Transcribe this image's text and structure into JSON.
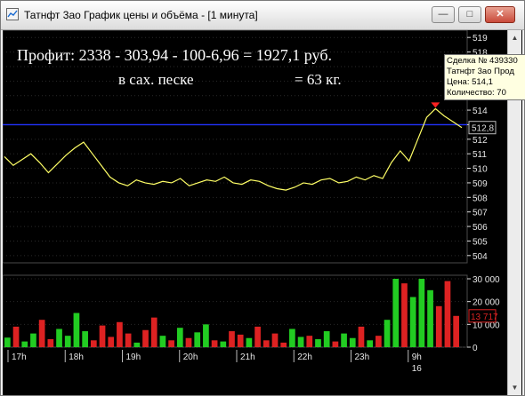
{
  "window": {
    "title": "Татнфт 3ао График цены и объёма - [1 минута]",
    "min_glyph": "—",
    "max_glyph": "□",
    "close_glyph": "✕",
    "icon": "chart-app-icon"
  },
  "overlay": {
    "line1": "Профит:  2338 - 303,94 - 100-6,96 = 1927,1 руб.",
    "line2a": "в сах. песке",
    "line2b": "= 63 кг."
  },
  "tooltip": {
    "line1": "Сделка № 439330",
    "line2": "Татнфт 3ао Прод",
    "line3": "Цена: 514,1",
    "line4": "Количество: 70"
  },
  "colors": {
    "price_line": "#ffff66",
    "level_line": "#2233ff",
    "volume_up": "#22cc22",
    "volume_down": "#dd2222",
    "price_marker": "#ff2222"
  },
  "chart_data": [
    {
      "type": "line",
      "title": "",
      "ylim": [
        503.5,
        519.5
      ],
      "y_ticks": [
        "519",
        "518",
        "517",
        "516",
        "515",
        "514",
        "513",
        "512",
        "511",
        "510",
        "509",
        "508",
        "507",
        "506",
        "505",
        "504"
      ],
      "current_price_label": "512,8",
      "horizontal_level": 513.0,
      "x": [
        "17h",
        "",
        "18h",
        "",
        "19h",
        "",
        "20h",
        "",
        "21h",
        "",
        "22h",
        "",
        "23h",
        "",
        "9h",
        "",
        "",
        ""
      ],
      "series": [
        {
          "values": [
            510.8,
            510.2,
            510.6,
            511.0,
            510.4,
            509.7,
            510.3,
            510.9,
            511.4,
            511.8,
            511.0,
            510.2,
            509.4,
            509.0,
            508.8,
            509.2,
            509.0,
            508.9,
            509.1,
            509.0,
            509.3,
            508.8,
            509.0,
            509.2,
            509.1,
            509.4,
            509.0,
            508.9,
            509.2,
            509.1,
            508.8,
            508.6,
            508.5,
            508.7,
            509.0,
            508.9,
            509.2,
            509.3,
            509.0,
            509.1,
            509.4,
            509.2,
            509.5,
            509.3,
            510.4,
            511.2,
            510.5,
            512.0,
            513.5,
            514.1,
            513.6,
            513.2,
            512.8
          ]
        }
      ]
    },
    {
      "type": "bar",
      "title": "",
      "ylim": [
        0,
        30000
      ],
      "y_ticks": [
        "30 000",
        "20 000",
        "10 000",
        "0"
      ],
      "current_value_label": "13 717",
      "x_labels": [
        "17h",
        "18h",
        "19h",
        "20h",
        "21h",
        "22h",
        "23h",
        "9h"
      ],
      "date_label": "16",
      "series": [
        {
          "name": "",
          "values": [
            4200,
            9000,
            2500,
            6000,
            12000,
            3500,
            8000,
            5000,
            15000,
            7000,
            3000,
            9500,
            4500,
            11000,
            6000,
            2000,
            7500,
            13000,
            5000,
            3000,
            8500,
            4000,
            6500,
            10000,
            3000,
            2500,
            7000,
            5500,
            4000,
            9000,
            3000,
            6000,
            2000,
            8000,
            4500,
            5000,
            3500,
            7000,
            2500,
            6000,
            4000,
            9000,
            3000,
            5000,
            12000,
            30000,
            28000,
            22000,
            30000,
            25000,
            18000,
            29000,
            13717
          ]
        }
      ]
    }
  ]
}
